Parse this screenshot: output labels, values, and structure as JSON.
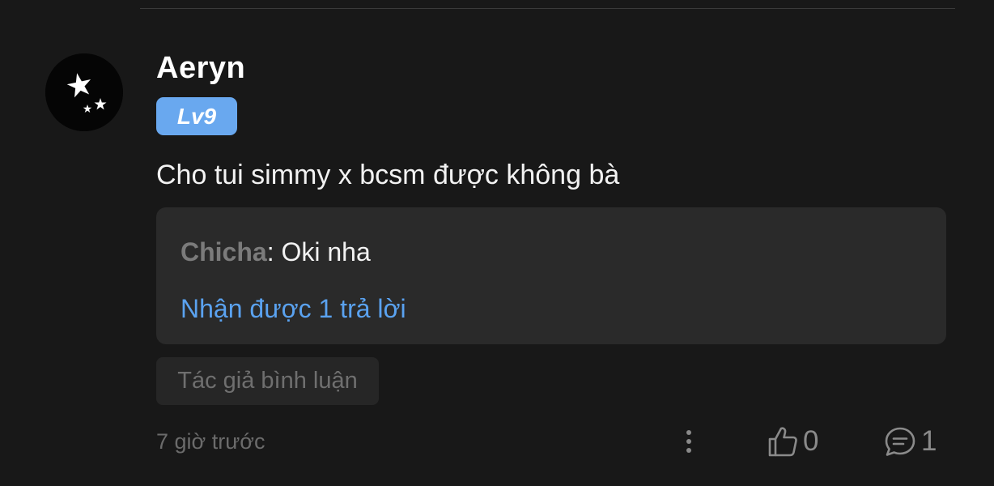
{
  "comment": {
    "username": "Aeryn",
    "level_badge": "Lv9",
    "text": "Cho tui simmy x bcsm được không bà",
    "timestamp": "7 giờ trước",
    "author_tag": "Tác giả bình luận",
    "avatar_icon": "stars-avatar-icon"
  },
  "reply_preview": {
    "author": "Chicha",
    "separator": ": ",
    "text": "Oki nha",
    "reply_count_label": "Nhận được 1 trả lời"
  },
  "actions": {
    "more_icon": "vertical-dots-icon",
    "like_icon": "thumbs-up-icon",
    "like_count": "0",
    "reply_icon": "speech-bubble-icon",
    "reply_count": "1"
  },
  "colors": {
    "background": "#181818",
    "badge": "#69a8ef",
    "link": "#5aa2f0",
    "reply_box": "#2a2a2a",
    "muted_text": "#6b6b6b"
  }
}
